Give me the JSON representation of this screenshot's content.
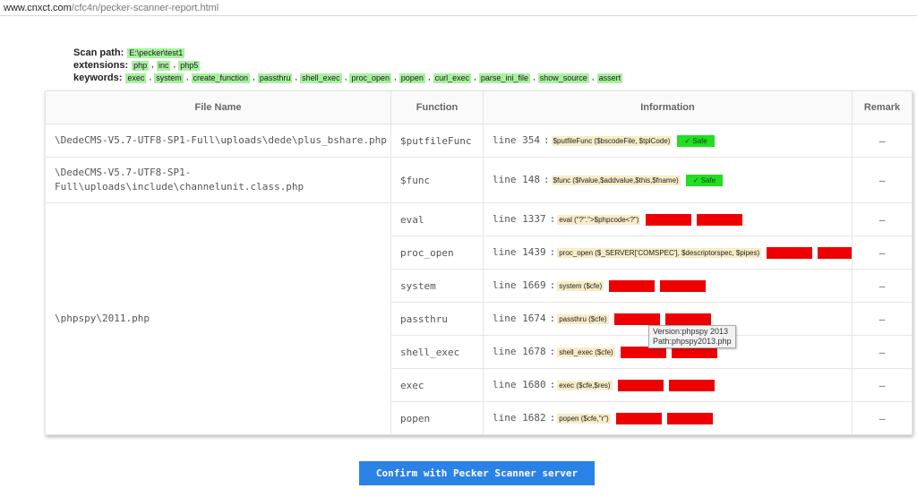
{
  "browser": {
    "url_domain": "www.cnxct.com",
    "url_path": "/cfc4n/pecker-scanner-report.html"
  },
  "meta": {
    "scan_path_label": "Scan path:",
    "scan_path": "E:\\pecker\\test1",
    "extensions_label": "extensions:",
    "extensions": [
      "php",
      "inc",
      "php5"
    ],
    "keywords_label": "keywords:",
    "keywords": [
      "exec",
      "system",
      "create_function",
      "passthru",
      "shell_exec",
      "proc_open",
      "popen",
      "curl_exec",
      "parse_ini_file",
      "show_source",
      "assert"
    ],
    "separator": ","
  },
  "table": {
    "headers": {
      "file": "File Name",
      "function": "Function",
      "information": "Information",
      "remark": "Remark"
    },
    "files": [
      {
        "name": "\\DedeCMS-V5.7-UTF8-SP1-Full\\uploads\\dede\\plus_bshare.php",
        "rows": [
          {
            "function": "$putfileFunc",
            "line": "line 354",
            "code": "$putfileFunc ($bscodeFile, $tplCode)",
            "status": "safe",
            "badge": "✓ Safe",
            "remark": "—"
          }
        ]
      },
      {
        "name": "\\DedeCMS-V5.7-UTF8-SP1-Full\\uploads\\include\\channelunit.class.php",
        "rows": [
          {
            "function": "$func",
            "line": "line 148",
            "code": "$func ($fvalue,$addvalue,$this,$fname)",
            "status": "safe",
            "badge": "✓ Safe",
            "remark": "—"
          }
        ]
      },
      {
        "name": "\\phpspy\\2011.php",
        "rows": [
          {
            "function": "eval",
            "line": "line 1337",
            "code": "eval (\"?\".\">$phpcode<?\")",
            "status": "danger",
            "remark": "—"
          },
          {
            "function": "proc_open",
            "line": "line 1439",
            "code": "proc_open ($_SERVER['COMSPEC'], $descriptorspec, $pipes)",
            "status": "danger",
            "remark": "—"
          },
          {
            "function": "system",
            "line": "line 1669",
            "code": "system ($cfe)",
            "status": "danger",
            "remark": "—"
          },
          {
            "function": "passthru",
            "line": "line 1674",
            "code": "passthru ($cfe)",
            "status": "danger",
            "remark": "—"
          },
          {
            "function": "shell_exec",
            "line": "line 1678",
            "code": "shell_exec ($cfe)",
            "status": "danger",
            "remark": "—"
          },
          {
            "function": "exec",
            "line": "line 1680",
            "code": "exec ($cfe,$res)",
            "status": "danger",
            "remark": "—"
          },
          {
            "function": "popen",
            "line": "line 1682",
            "code": "popen ($cfe,\"r\")",
            "status": "danger",
            "remark": "—"
          }
        ]
      }
    ]
  },
  "tooltip": {
    "version": "Version:phpspy 2013",
    "path": "Path:phpspy2013.php"
  },
  "confirm_label": "Confirm with Pecker Scanner server",
  "colors": {
    "safe": "#22dd22",
    "danger": "#ee0000",
    "code_bg": "#f7ecc8",
    "tag_bg": "#a8f0a0",
    "button": "#2b82e6"
  }
}
